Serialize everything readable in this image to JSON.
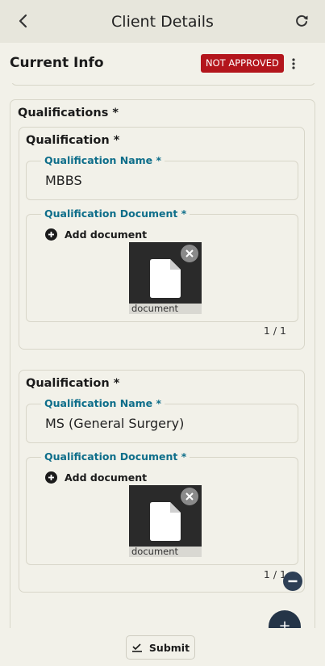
{
  "appbar": {
    "title": "Client Details"
  },
  "header": {
    "title": "Current Info",
    "status_badge": "NOT APPROVED"
  },
  "section": {
    "title": "Qualifications *"
  },
  "qualifications": [
    {
      "card_title": "Qualification *",
      "name_label": "Qualification Name *",
      "name_value": "MBBS",
      "document_label": "Qualification Document *",
      "add_document_label": "Add document",
      "document_caption": "document",
      "pager": "1 / 1"
    },
    {
      "card_title": "Qualification *",
      "name_label": "Qualification Name *",
      "name_value": "MS (General Surgery)",
      "document_label": "Qualification Document *",
      "add_document_label": "Add document",
      "document_caption": "document",
      "pager": "1 / 1"
    }
  ],
  "fab": {
    "label": "+"
  },
  "footer": {
    "submit_label": "Submit"
  },
  "colors": {
    "badge": "#b3151c",
    "label": "#0e6e8a",
    "fab": "#243447"
  }
}
